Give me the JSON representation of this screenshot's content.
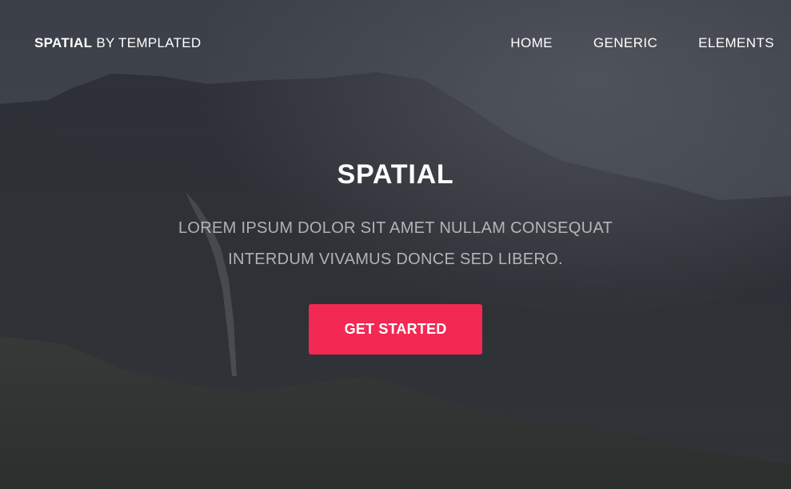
{
  "header": {
    "logo_strong": "SPATIAL",
    "logo_light": "BY TEMPLATED",
    "nav": [
      {
        "label": "HOME"
      },
      {
        "label": "GENERIC"
      },
      {
        "label": "ELEMENTS"
      }
    ]
  },
  "banner": {
    "title": "SPATIAL",
    "text": "LOREM IPSUM DOLOR SIT AMET NULLAM CONSEQUAT INTERDUM VIVAMUS DONCE SED LIBERO.",
    "cta_label": "GET STARTED"
  },
  "colors": {
    "accent": "#f32853",
    "text": "#ffffff",
    "overlay": "#2f323a"
  }
}
